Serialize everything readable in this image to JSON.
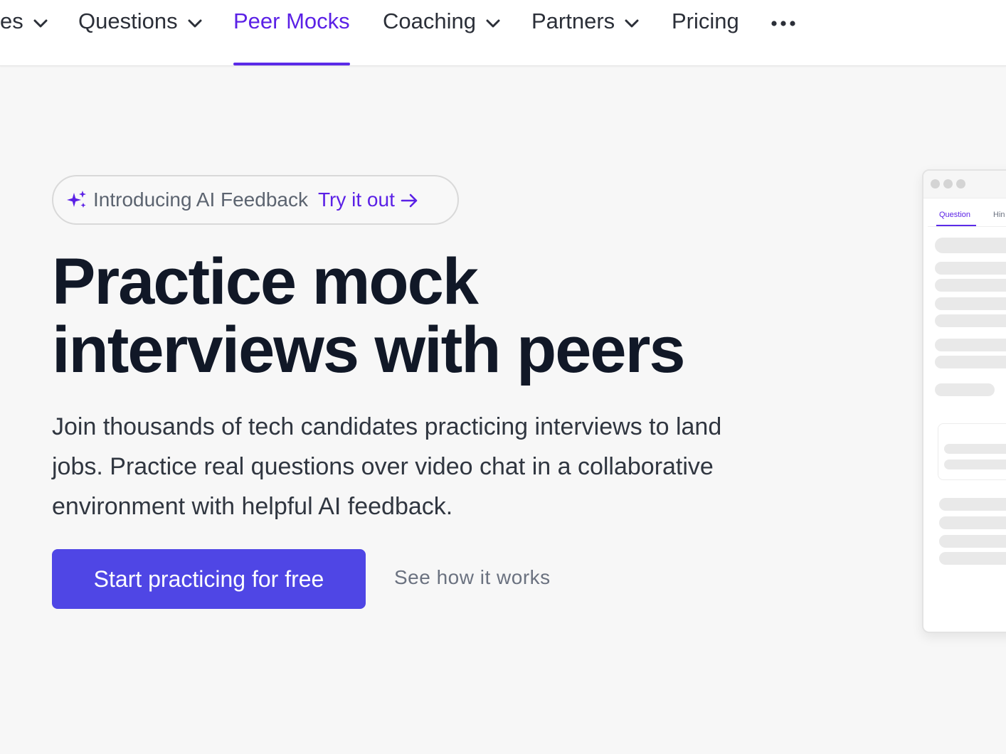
{
  "nav": {
    "items": [
      {
        "label": "es",
        "has_chevron": true
      },
      {
        "label": "Questions",
        "has_chevron": true
      },
      {
        "label": "Peer Mocks",
        "has_chevron": false,
        "active": true
      },
      {
        "label": "Coaching",
        "has_chevron": true
      },
      {
        "label": "Partners",
        "has_chevron": true
      },
      {
        "label": "Pricing",
        "has_chevron": false
      }
    ],
    "more_icon": "ellipsis-icon"
  },
  "announcement": {
    "icon": "sparkle-icon",
    "text": "Introducing AI Feedback",
    "link_text": "Try it out",
    "link_icon": "arrow-right-icon"
  },
  "hero": {
    "headline_line1": "Practice mock",
    "headline_line2": "interviews with peers",
    "subtext": "Join thousands of tech candidates practicing interviews to land jobs. Practice real questions over video chat in a collaborative environment with helpful AI feedback.",
    "primary_cta": "Start practicing for free",
    "secondary_cta": "See how it works"
  },
  "preview": {
    "tabs": [
      "Question",
      "Hin"
    ]
  },
  "colors": {
    "accent": "#5b21e6",
    "button": "#4f46e5",
    "background": "#f7f7f7"
  }
}
